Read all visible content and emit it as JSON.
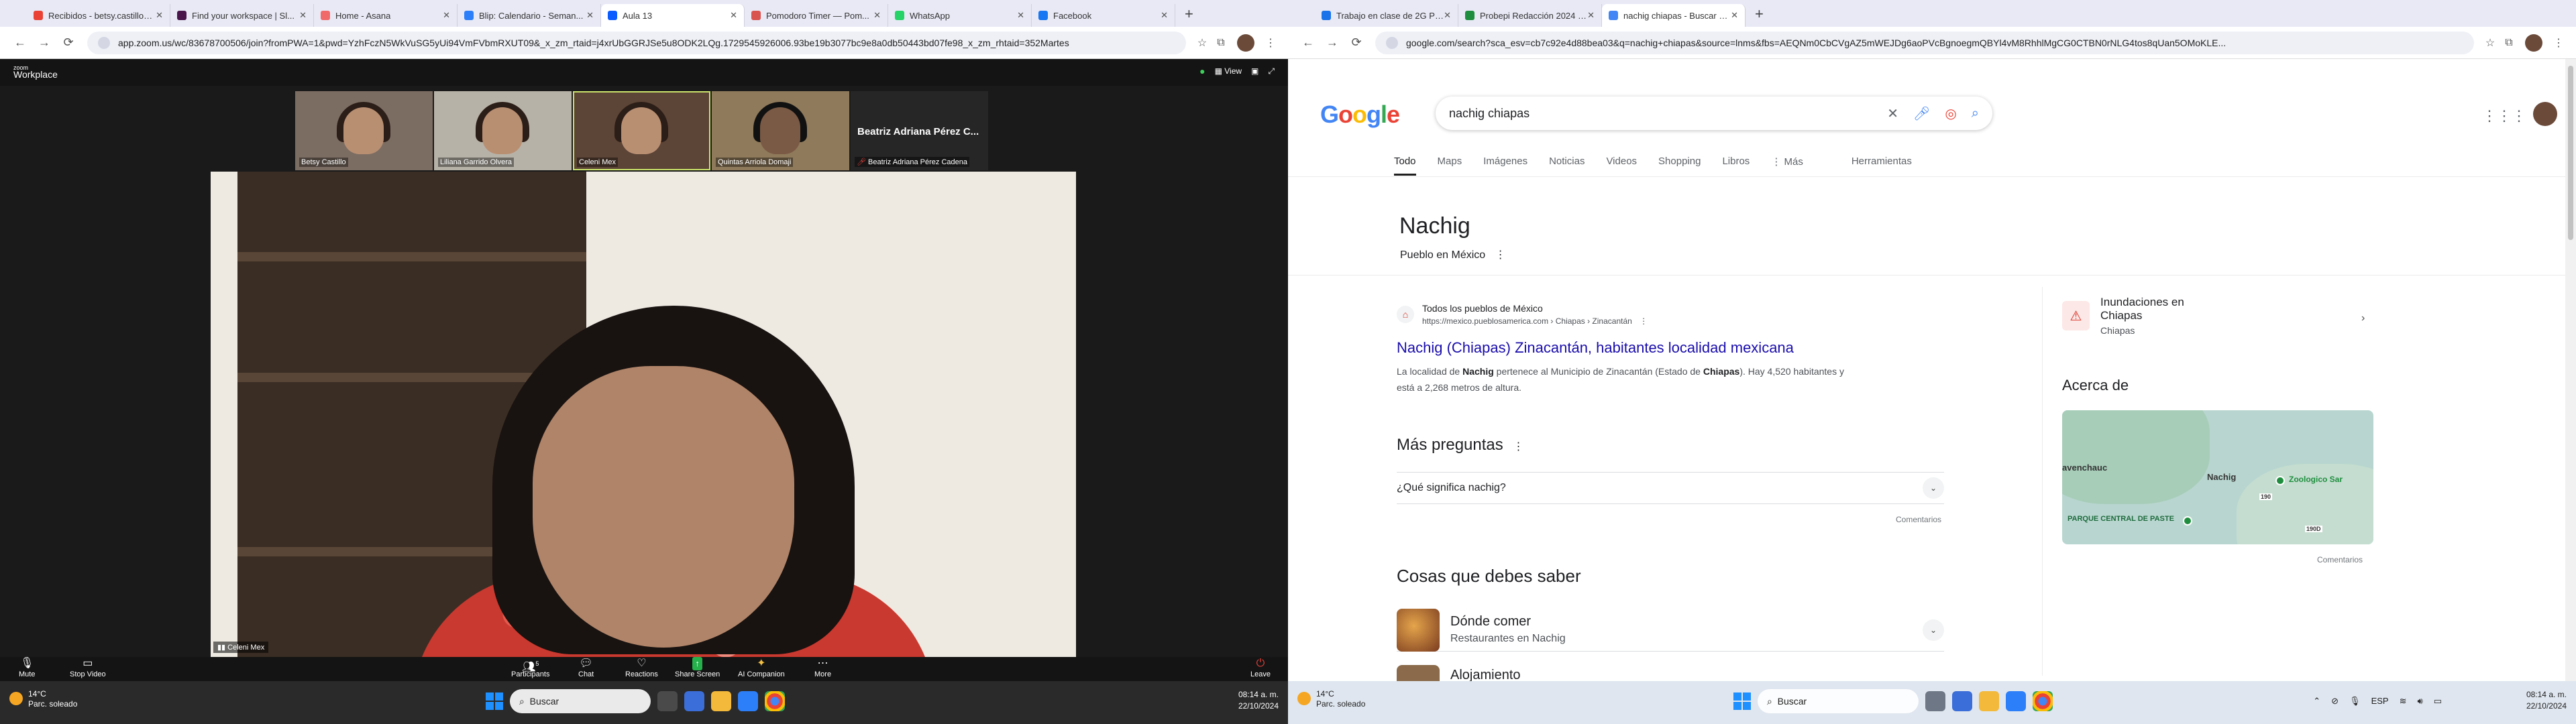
{
  "left_browser": {
    "tabs": [
      {
        "label": "Recibidos - betsy.castillo@...",
        "color": "#ea4335"
      },
      {
        "label": "Find your workspace | Sl...",
        "color": "#4a154b"
      },
      {
        "label": "Home - Asana",
        "color": "#f06a6a"
      },
      {
        "label": "Blip: Calendario - Seman...",
        "color": "#2d7ff9"
      },
      {
        "label": "Aula 13",
        "color": "#0b5cff"
      },
      {
        "label": "Pomodoro Timer — Pom...",
        "color": "#d9534f"
      },
      {
        "label": "WhatsApp",
        "color": "#25d366"
      },
      {
        "label": "Facebook",
        "color": "#1877f2"
      }
    ],
    "active_tab": 4,
    "url": "app.zoom.us/wc/83678700506/join?fromPWA=1&pwd=YzhFczN5WkVuSG5yUi94VmFVbmRXUT09&_x_zm_rtaid=j4xrUbGGRJSe5u8ODK2LQg.1729545926006.93be19b3077bc9e8a0db50443bd07fe98_x_zm_rhtaid=352Martes"
  },
  "zoom": {
    "logo_small": "zoom",
    "logo_big": "Workplace",
    "view_label": "View",
    "participants": [
      {
        "name": "Betsy Castillo"
      },
      {
        "name": "Liliana Garrido Olvera"
      },
      {
        "name": "Celeni Mex"
      },
      {
        "name": "Quintas Arriola Domaji"
      }
    ],
    "name_card_big": "Beatriz Adriana Pérez C...",
    "name_card_small": "Beatriz Adriana Pérez Cadena",
    "main_video_label": "Celeni Mex",
    "toolbar": {
      "mute": "Mute",
      "stop_video": "Stop Video",
      "participants": "Participants",
      "participants_count": "5",
      "chat": "Chat",
      "reactions": "Reactions",
      "share_screen": "Share Screen",
      "ai_companion": "AI Companion",
      "more": "More",
      "leave": "Leave"
    }
  },
  "right_browser": {
    "tabs": [
      {
        "label": "Trabajo en clase de 2G Probep...",
        "color": "#1a73e8"
      },
      {
        "label": "Probepi Redacción 2024 Grupo...",
        "color": "#1e8e3e"
      },
      {
        "label": "nachig chiapas - Buscar con Go...",
        "color": "#4285f4"
      }
    ],
    "active_tab": 2,
    "url": "google.com/search?sca_esv=cb7c92e4d88bea03&q=nachig+chiapas&source=lnms&fbs=AEQNm0CbCVgAZ5mWEJDg6aoPVcBgnoegmQBYl4vM8RhhlMgCG0CTBN0rNLG4tos8qUan5OMoKLE..."
  },
  "google": {
    "logo": "Google",
    "query": "nachig chiapas",
    "tabs": [
      "Todo",
      "Maps",
      "Imágenes",
      "Noticias",
      "Videos",
      "Shopping",
      "Libros",
      "⋮ Más",
      "Herramientas"
    ],
    "kp_title": "Nachig",
    "kp_subtitle": "Pueblo en México",
    "result": {
      "site": "Todos los pueblos de México",
      "url": "https://mexico.pueblosamerica.com › Chiapas › Zinacantán",
      "title": "Nachig (Chiapas) Zinacantán, habitantes localidad mexicana",
      "snippet_a": "La localidad de ",
      "snippet_b": "Nachig",
      "snippet_c": " pertenece al Municipio de Zinacantán (Estado de ",
      "snippet_d": "Chiapas",
      "snippet_e": "). Hay 4,520 habitantes y está a 2,268 metros de altura."
    },
    "paa_title": "Más preguntas",
    "paa_q1": "¿Qué significa nachig?",
    "feedback": "Comentarios",
    "ctk_title": "Cosas que debes saber",
    "ctk_item_title": "Dónde comer",
    "ctk_item_sub": "Restaurantes en Nachig",
    "ctk_item2_title": "Alojamiento",
    "side_card_title": "Inundaciones en Chiapas",
    "side_card_sub": "Chiapas",
    "about_title": "Acerca de",
    "map_labels": [
      "avenchauc",
      "Nachig",
      "Zoologico Sar",
      "PARQUE CENTRAL DE PASTE",
      "190",
      "190D"
    ]
  },
  "taskbar_left": {
    "temp": "14°C",
    "weather": "Parc. soleado",
    "search": "Buscar",
    "time": "08:14 a. m.",
    "date": "22/10/2024"
  },
  "taskbar_right": {
    "temp": "14°C",
    "weather": "Parc. soleado",
    "search": "Buscar",
    "lang": "ESP",
    "time": "08:14 a. m.",
    "date": "22/10/2024"
  }
}
